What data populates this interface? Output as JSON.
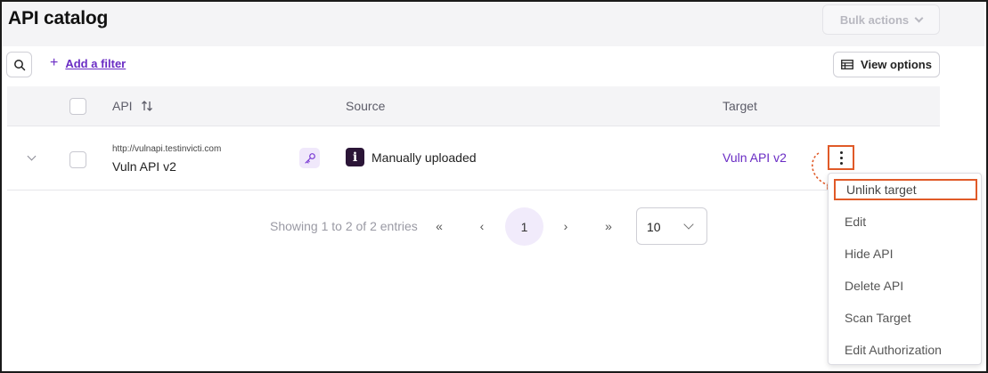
{
  "header": {
    "title": "API catalog",
    "bulk_actions_label": "Bulk actions"
  },
  "toolbar": {
    "add_filter_label": "Add a filter",
    "view_options_label": "View options"
  },
  "table": {
    "columns": {
      "api": "API",
      "source": "Source",
      "target": "Target"
    },
    "rows": [
      {
        "url": "http://vulnapi.testinvicti.com",
        "name": "Vuln API v2",
        "source_icon": "i",
        "source": "Manually uploaded",
        "target": "Vuln API v2"
      }
    ]
  },
  "pagination": {
    "info": "Showing 1 to 2 of 2 entries",
    "first": "«",
    "prev": "‹",
    "current": "1",
    "next": "›",
    "last": "»",
    "page_size": "10"
  },
  "row_menu": {
    "items": [
      {
        "label": "Unlink target",
        "highlighted": true
      },
      {
        "label": "Edit"
      },
      {
        "label": "Hide API"
      },
      {
        "label": "Delete API"
      },
      {
        "label": "Scan Target"
      },
      {
        "label": "Edit Authorization"
      }
    ]
  },
  "colors": {
    "accent": "#6a2cc4",
    "highlight_border": "#e05a28",
    "source_icon_bg": "#2b1537"
  }
}
